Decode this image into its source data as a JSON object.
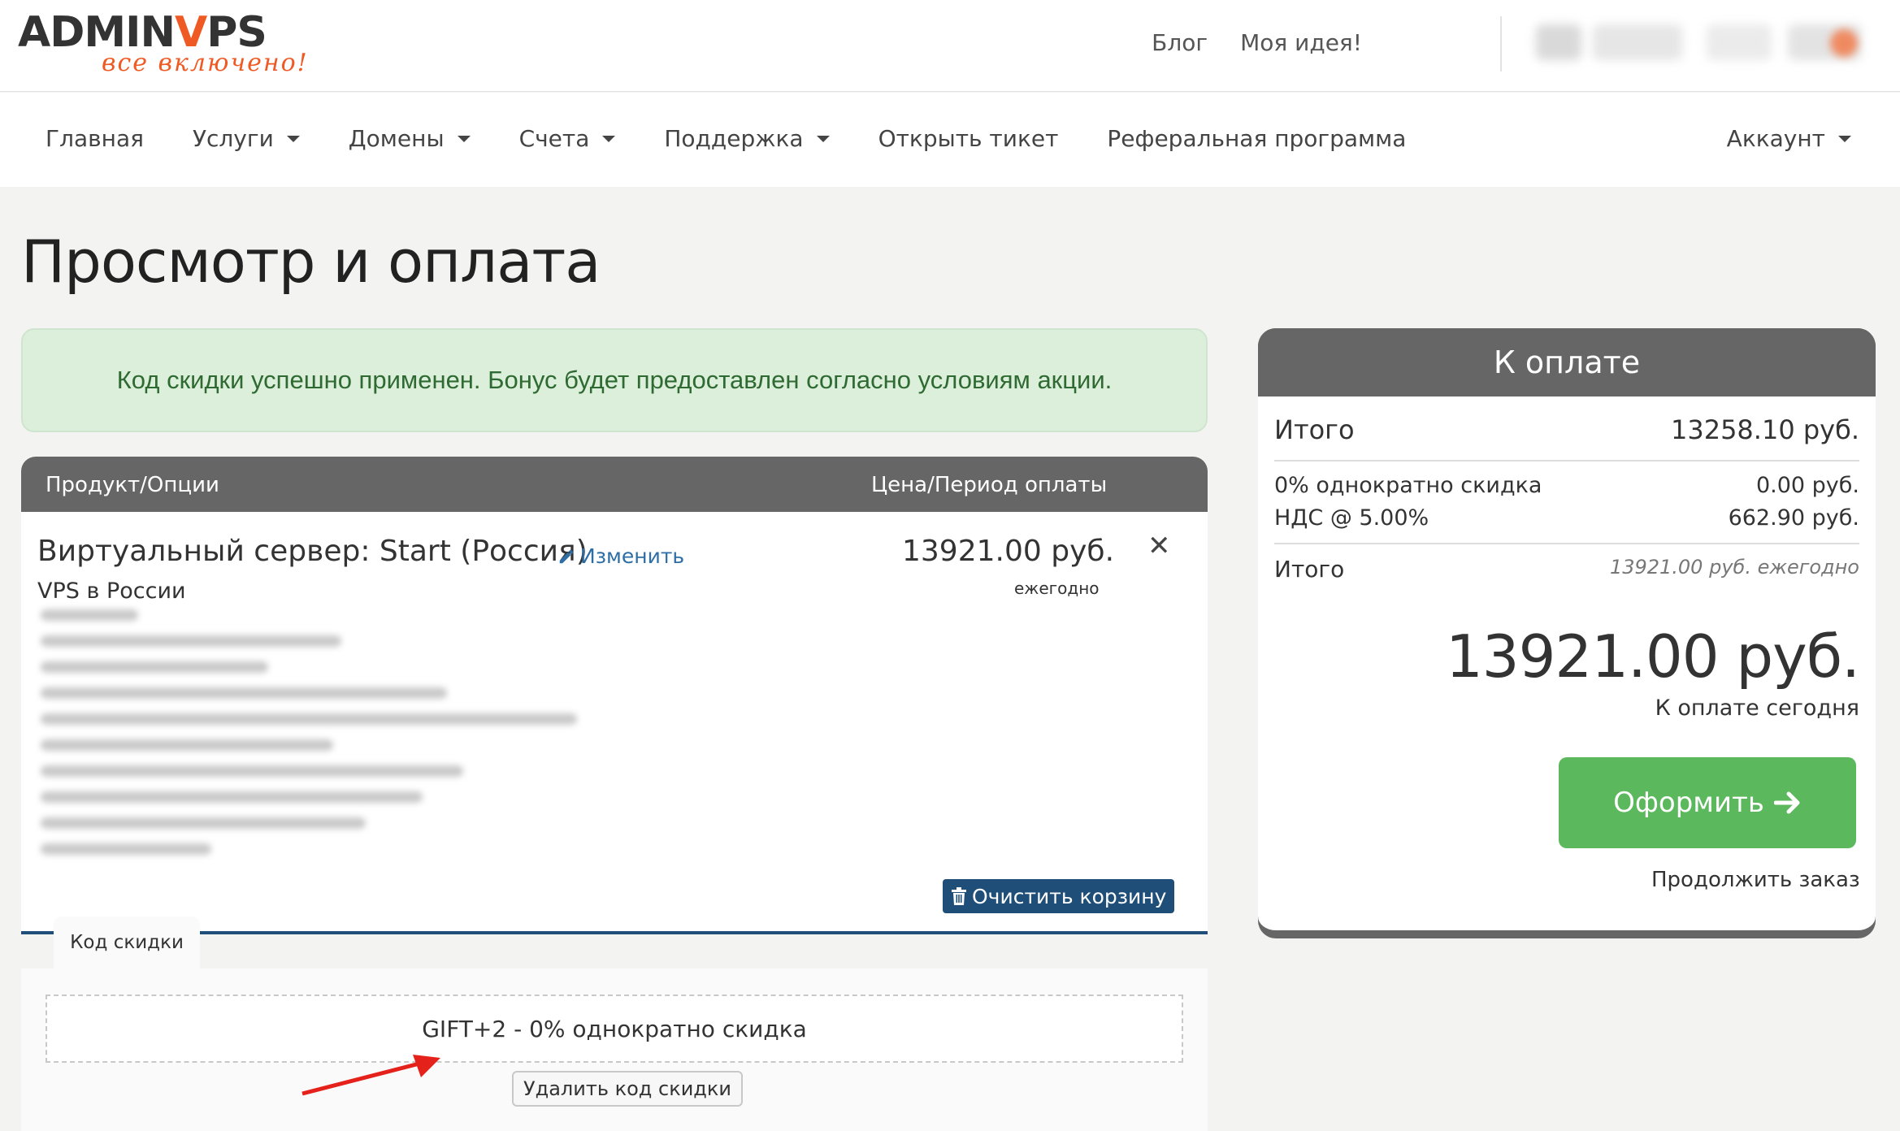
{
  "brand": {
    "logo_left": "ADMIN",
    "logo_v": "V",
    "logo_right": "PS",
    "tagline": "все включено!",
    "accent_color": "#ef5a24"
  },
  "top_links": {
    "blog": "Блог",
    "idea": "Моя идея!"
  },
  "nav": {
    "items": [
      {
        "label": "Главная",
        "dropdown": false
      },
      {
        "label": "Услуги",
        "dropdown": true
      },
      {
        "label": "Домены",
        "dropdown": true
      },
      {
        "label": "Счета",
        "dropdown": true
      },
      {
        "label": "Поддержка",
        "dropdown": true
      },
      {
        "label": "Открыть тикет",
        "dropdown": false
      },
      {
        "label": "Реферальная программа",
        "dropdown": false
      }
    ],
    "account": "Аккаунт"
  },
  "page": {
    "title": "Просмотр и оплата"
  },
  "alert": {
    "message": "Код скидки успешно применен. Бонус будет предоставлен согласно условиям акции.",
    "color": "#2f6a32"
  },
  "cart": {
    "col_product": "Продукт/Опции",
    "col_price": "Цена/Период оплаты",
    "item": {
      "name": "Виртуальный сервер: Start (Россия)",
      "edit": "Изменить",
      "group": "VPS в России",
      "price": "13921.00 руб.",
      "period": "ежегодно",
      "remove_icon": "close-icon"
    },
    "clear_button": "Очистить корзину"
  },
  "promo": {
    "tab": "Код скидки",
    "applied": "GIFT+2 - 0% однократно скидка",
    "remove_button": "Удалить код скидки"
  },
  "summary": {
    "title": "К оплате",
    "subtotal_label": "Итого",
    "subtotal_value": "13258.10 руб.",
    "discount_label": "0% однократно скидка",
    "discount_value": "0.00 руб.",
    "tax_label": "НДС @ 5.00%",
    "tax_value": "662.90 руб.",
    "total_label": "Итого",
    "total_recurring": "13921.00 руб. ежегодно",
    "due_amount": "13921.00 руб.",
    "due_label": "К оплате сегодня",
    "checkout_button": "Оформить",
    "continue_link": "Продолжить заказ",
    "checkout_color": "#5cb85c"
  }
}
